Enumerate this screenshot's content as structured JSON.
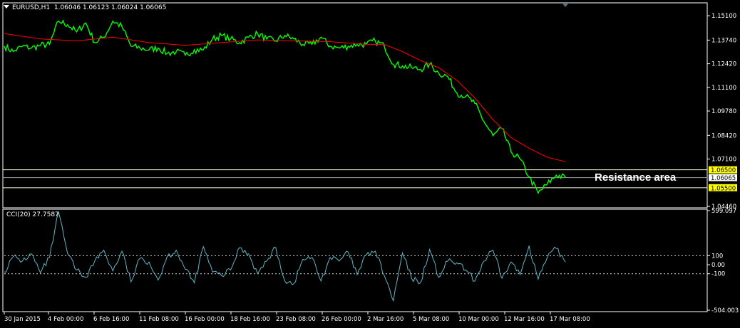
{
  "header": {
    "symbol": "EURUSD,H1",
    "ohlc": "1.06046 1.06123 1.06024 1.06065"
  },
  "annotation": {
    "resistance_label": "Resistance area"
  },
  "colors": {
    "background": "#000000",
    "price": "#00ff00",
    "moving_average": "#ff0000",
    "cci": "#5fb7c8",
    "level_lines": "#ffffd0",
    "level_highlight": "#ffff00",
    "current_price_box": "#ffffff",
    "axis_text": "#ffffff"
  },
  "chart_data": [
    {
      "type": "line",
      "title": "EURUSD,H1",
      "ylim": [
        1.0446,
        1.1574
      ],
      "y_ticks": [
        "1.15100",
        "1.13740",
        "1.12420",
        "1.11100",
        "1.09780",
        "1.08420",
        "1.07100",
        "1.04460"
      ],
      "x_ticks": [
        "30 Jan 2015",
        "4 Feb 00:00",
        "6 Feb 16:00",
        "11 Feb 08:00",
        "16 Feb 00:00",
        "18 Feb 16:00",
        "23 Feb 08:00",
        "26 Feb 00:00",
        "2 Mar 16:00",
        "5 Mar 08:00",
        "10 Mar 00:00",
        "12 Mar 16:00",
        "17 Mar 08:00"
      ],
      "levels": [
        {
          "value": 1.065,
          "label": "1.06500",
          "highlight": true
        },
        {
          "value": 1.055,
          "label": "1.05500",
          "highlight": true
        }
      ],
      "current_price": {
        "value": 1.06065,
        "label": "1.06065"
      },
      "series": [
        {
          "name": "",
          "role": "price",
          "x": [
            0,
            1,
            2,
            3,
            4,
            5,
            6,
            7,
            8,
            9,
            10,
            11,
            12,
            13,
            14,
            15,
            16,
            17,
            18,
            19,
            20,
            21,
            22,
            23,
            24,
            25,
            26,
            27,
            28,
            29,
            30,
            31,
            32,
            33,
            34,
            35,
            36,
            37,
            38,
            39,
            40,
            41,
            42,
            43,
            44,
            45,
            46,
            47,
            48,
            49,
            50,
            51,
            52,
            53,
            54,
            55,
            56,
            57,
            58,
            59,
            60,
            61,
            62
          ],
          "values": [
            1.134,
            1.131,
            1.134,
            1.133,
            1.1345,
            1.135,
            1.148,
            1.146,
            1.142,
            1.147,
            1.136,
            1.139,
            1.148,
            1.145,
            1.134,
            1.133,
            1.132,
            1.133,
            1.13,
            1.131,
            1.129,
            1.132,
            1.132,
            1.138,
            1.14,
            1.138,
            1.136,
            1.139,
            1.141,
            1.138,
            1.137,
            1.14,
            1.138,
            1.135,
            1.135,
            1.139,
            1.134,
            1.133,
            1.134,
            1.135,
            1.135,
            1.137,
            1.134,
            1.124,
            1.123,
            1.122,
            1.121,
            1.124,
            1.119,
            1.117,
            1.108,
            1.106,
            1.102,
            1.092,
            1.084,
            1.088,
            1.075,
            1.071,
            1.061,
            1.052,
            1.057,
            1.062,
            1.0607
          ]
        },
        {
          "name": "",
          "role": "moving_average",
          "x": [
            0,
            4,
            8,
            12,
            16,
            20,
            24,
            28,
            32,
            36,
            40,
            42,
            44,
            46,
            48,
            50,
            52,
            54,
            56,
            58,
            60,
            62
          ],
          "values": [
            1.141,
            1.138,
            1.137,
            1.139,
            1.136,
            1.1345,
            1.136,
            1.1375,
            1.137,
            1.1365,
            1.135,
            1.135,
            1.131,
            1.126,
            1.122,
            1.115,
            1.105,
            1.093,
            1.083,
            1.077,
            1.072,
            1.0695
          ]
        }
      ]
    },
    {
      "type": "line",
      "title": "CCI(20) 27.7587",
      "ylim": [
        -504.003,
        599.097
      ],
      "y_ticks": [
        "599.097",
        "100",
        "0.00",
        "-100",
        "-504.003"
      ],
      "reference_lines": [
        100,
        -100
      ],
      "series": [
        {
          "name": "CCI(20)",
          "x": [
            0,
            1,
            2,
            3,
            4,
            5,
            6,
            7,
            8,
            9,
            10,
            11,
            12,
            13,
            14,
            15,
            16,
            17,
            18,
            19,
            20,
            21,
            22,
            23,
            24,
            25,
            26,
            27,
            28,
            29,
            30,
            31,
            32,
            33,
            34,
            35,
            36,
            37,
            38,
            39,
            40,
            41,
            42,
            43,
            44,
            45,
            46,
            47,
            48,
            49,
            50,
            51,
            52,
            53,
            54,
            55,
            56,
            57,
            58,
            59,
            60,
            61,
            62
          ],
          "values": [
            -80,
            90,
            40,
            120,
            -90,
            80,
            580,
            120,
            -60,
            -140,
            40,
            160,
            -70,
            150,
            -190,
            70,
            30,
            -170,
            90,
            160,
            -50,
            -200,
            200,
            -80,
            -120,
            -60,
            190,
            120,
            -100,
            40,
            190,
            -180,
            -210,
            60,
            80,
            -180,
            80,
            40,
            140,
            -110,
            110,
            150,
            -120,
            -400,
            130,
            -150,
            -200,
            170,
            -140,
            40,
            20,
            -60,
            -180,
            40,
            160,
            -150,
            30,
            -110,
            210,
            -160,
            80,
            180,
            28
          ]
        }
      ]
    }
  ]
}
